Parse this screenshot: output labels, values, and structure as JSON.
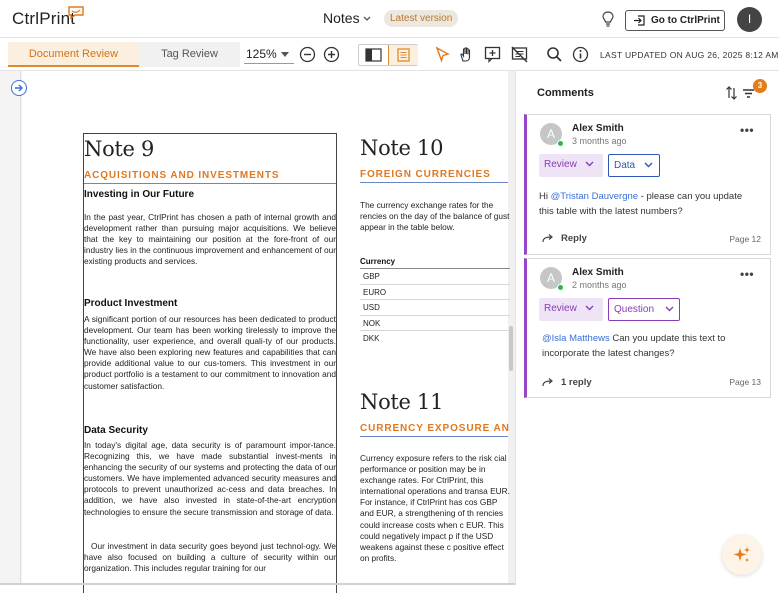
{
  "header": {
    "logo": "CtrlPrint",
    "doc_title": "Notes",
    "version_badge": "Latest version",
    "goto_label": "Go to CtrlPrint",
    "user_initial": "I"
  },
  "toolbar": {
    "tabs": [
      {
        "label": "Document Review",
        "active": true
      },
      {
        "label": "Tag Review",
        "active": false
      }
    ],
    "zoom": "125%",
    "last_updated": "LAST UPDATED ON AUG 26, 2025 8:12 AM"
  },
  "document": {
    "note9": {
      "title": "Note 9",
      "subtitle": "ACQUISITIONS AND INVESTMENTS",
      "section1_heading": "Investing in Our Future",
      "section1_text": "In the past year, CtrlPrint has chosen a path of internal growth and development rather than pursuing major acquisitions. We believe that the key to maintaining our position at the fore-front of our industry lies in the continuous improvement and enhancement of our existing products and services.",
      "section2_heading": "Product Investment",
      "section2_text": "A significant portion of our resources has been dedicated to product development. Our team has been working tirelessly to improve the functionality, user experience, and overall quali-ty of our products. We have also been exploring new features and capabilities that can provide additional value to our cus-tomers. This investment in our product portfolio is a testament to our commitment to innovation and customer satisfaction.",
      "section3_heading": "Data Security",
      "section3_text": "In today's digital age, data security is of paramount impor-tance. Recognizing this, we have made substantial invest-ments in enhancing the security of our systems and protecting the data of our customers. We have implemented advanced security measures and protocols to prevent unauthorized ac-cess and data breaches. In addition, we have also invested in state-of-the-art encryption technologies to ensure the secure transmission and storage of data.",
      "section3_text2": "Our investment in data security goes beyond just technol-ogy. We have also focused on building a culture of security within our organization. This includes regular training for our"
    },
    "note10": {
      "title": "Note 10",
      "subtitle": "FOREIGN CURRENCIES",
      "text": "The currency exchange rates for the rencies on the day of the balance of gust appear in the table below.",
      "table_header": "Currency",
      "currencies": [
        "GBP",
        "EURO",
        "USD",
        "NOK",
        "DKK"
      ]
    },
    "note11": {
      "title": "Note 11",
      "subtitle": "CURRENCY EXPOSURE AN",
      "text": "Currency exposure refers to the risk cial performance or position may be in exchange rates. For CtrlPrint, this international operations and transa EUR. For instance, if CtrlPrint has cos GBP and EUR, a strengthening of th rencies could increase costs when c EUR. This could negatively impact p if the USD weakens against these c positive effect on profits."
    }
  },
  "comments_panel": {
    "title": "Comments",
    "filter_count": "3",
    "comments": [
      {
        "author_initial": "A",
        "author": "Alex Smith",
        "time": "3 months ago",
        "status": "Review",
        "tag": "Data",
        "mention": "@Tristan Dauvergne",
        "body_prefix": "Hi ",
        "body_rest": " - please can you update this table with the latest numbers?",
        "reply_label": "Reply",
        "page": "Page 12"
      },
      {
        "author_initial": "A",
        "author": "Alex Smith",
        "time": "2 months ago",
        "status": "Review",
        "tag": "Question",
        "mention": "@Isla Matthews",
        "body_prefix": "",
        "body_rest": " Can you update this text to incorporate the latest changes?",
        "reply_label": "1 reply",
        "page": "Page 13"
      }
    ]
  },
  "colors": {
    "accent_orange": "#e07820",
    "comment_purple": "#9a45c8",
    "mention_blue": "#3a6fd8"
  }
}
